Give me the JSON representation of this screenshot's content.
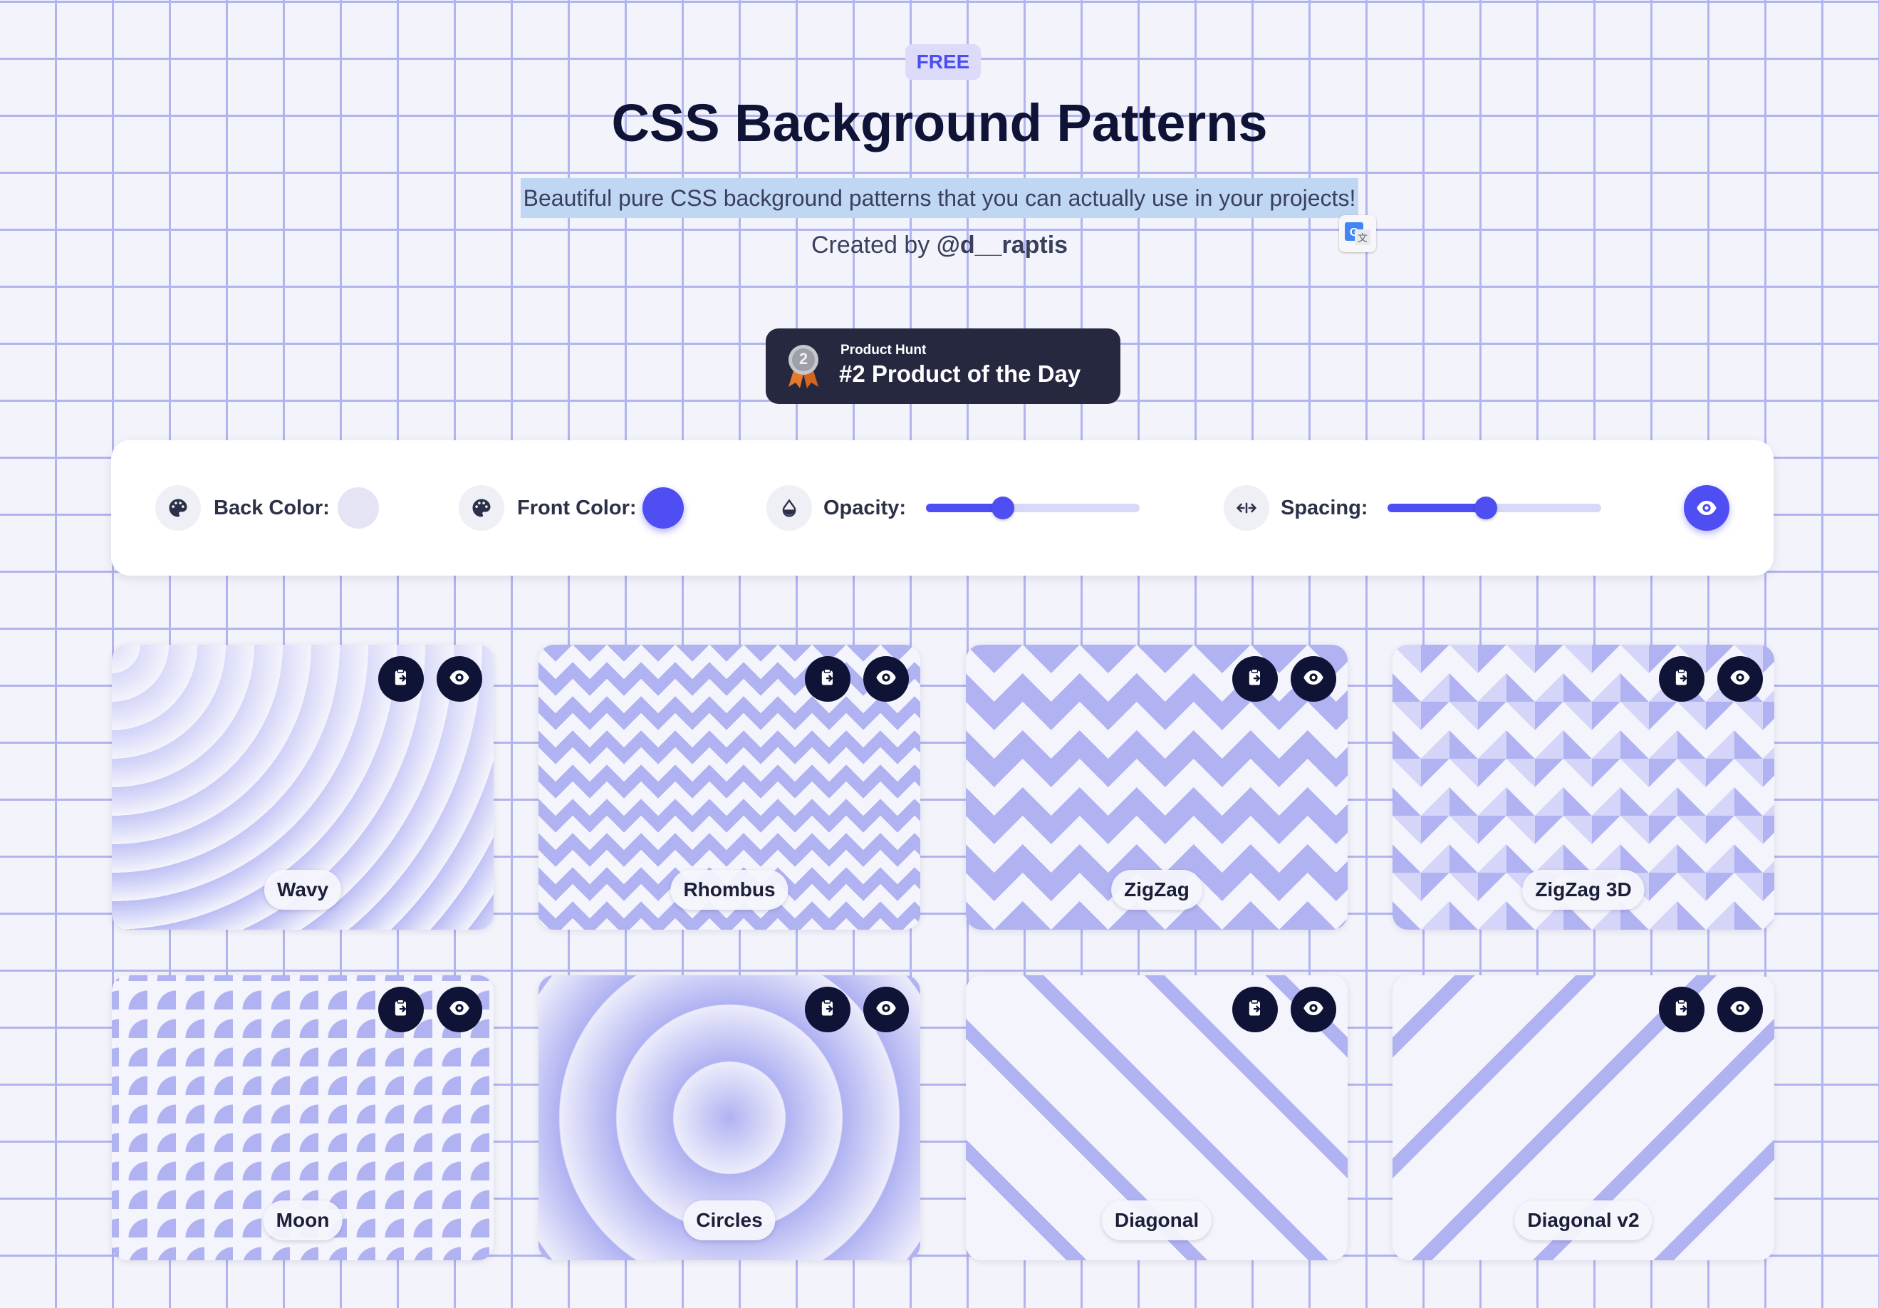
{
  "header": {
    "badge": "FREE",
    "title": "CSS Background Patterns",
    "subtitle": "Beautiful pure CSS background patterns that you can actually use in your projects!",
    "created_by_prefix": "Created by",
    "author": "@d__raptis"
  },
  "product_hunt": {
    "kicker": "Product Hunt",
    "title": "#2 Product of the Day",
    "medal_number": "2"
  },
  "controls": {
    "back_color_label": "Back Color:",
    "back_color": "#e5e4f5",
    "front_color_label": "Front Color:",
    "front_color": "#4e4ef3",
    "opacity_label": "Opacity:",
    "opacity_value": 0.36,
    "spacing_label": "Spacing:",
    "spacing_value": 0.46,
    "icons": [
      "palette-icon",
      "palette-icon",
      "droplet-icon",
      "arrows-horizontal-icon",
      "eye-icon"
    ]
  },
  "patterns": [
    {
      "name": "Wavy"
    },
    {
      "name": "Rhombus"
    },
    {
      "name": "ZigZag"
    },
    {
      "name": "ZigZag 3D"
    },
    {
      "name": "Moon"
    },
    {
      "name": "Circles"
    },
    {
      "name": "Diagonal"
    },
    {
      "name": "Diagonal v2"
    }
  ],
  "colors": {
    "accent": "#4e4ef3",
    "dark": "#0f1336",
    "grid_line": "#b2b4ef",
    "background": "#f3f4fb"
  }
}
